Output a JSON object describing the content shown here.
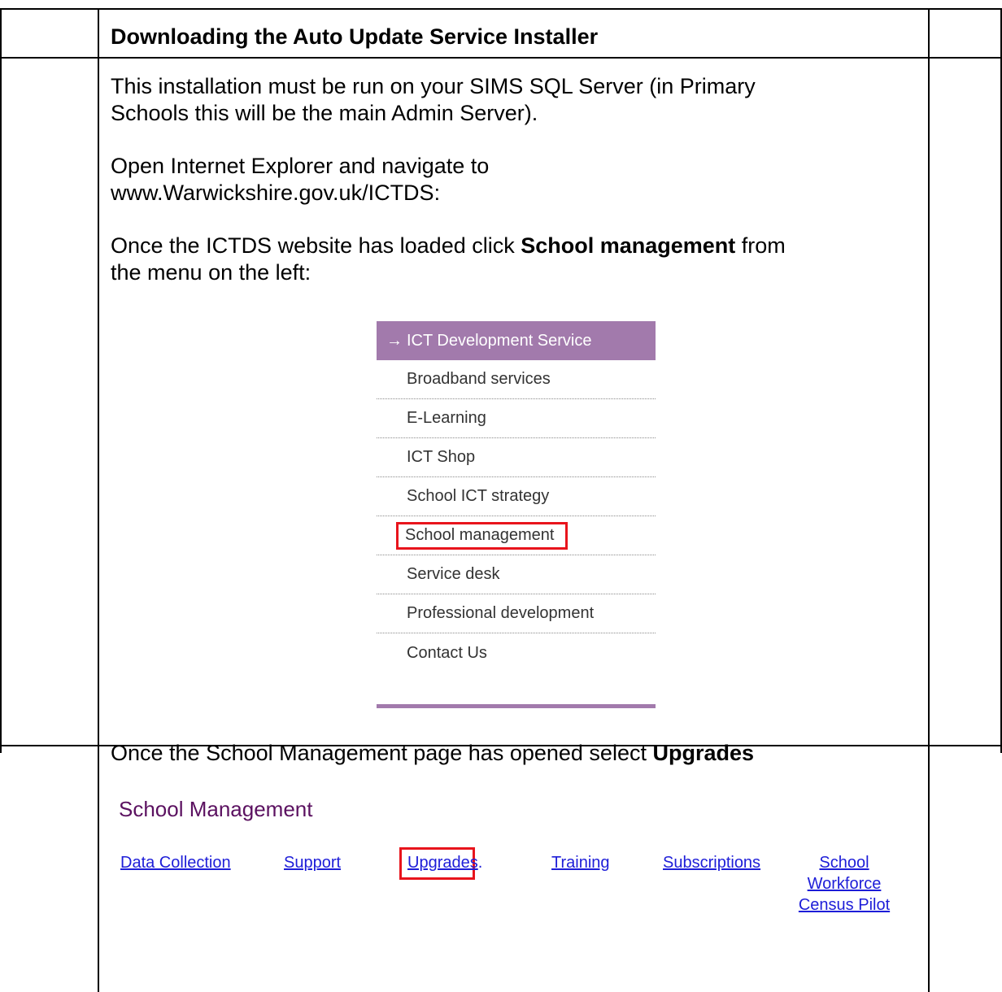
{
  "heading": "Downloading the Auto Update Service Installer",
  "paragraphs": {
    "p1_line1": "This installation must be run on your SIMS SQL Server (in Primary",
    "p1_line2": "Schools this will be the main Admin Server).",
    "p2_line1": "Open Internet Explorer and navigate to",
    "p2_line2": "www.Warwickshire.gov.uk/ICTDS:",
    "p3_pre": "Once the ICTDS website has loaded click ",
    "p3_bold": "School management",
    "p3_post": " from",
    "p3_line2": "the menu on the left:",
    "p4_pre": "Once the School Management page has opened select ",
    "p4_bold": "Upgrades"
  },
  "menu": {
    "header": "ICT Development Service",
    "header_icon": "arrow-right-icon",
    "items": [
      "Broadband services",
      "E-Learning",
      "ICT Shop",
      "School ICT strategy",
      "School management",
      "Service desk",
      "Professional development",
      "Contact Us"
    ],
    "highlighted_item": "School management",
    "accent_color": "#a27aac",
    "highlight_color": "#e8141c"
  },
  "school_management": {
    "title": "School Management",
    "links": {
      "data_collection": "Data Collection",
      "support": "Support",
      "upgrades": "Upgrades",
      "upgrades_suffix": ".",
      "training": "Training",
      "subscriptions": "Subscriptions",
      "school_workforce_1": "School",
      "school_workforce_2": "Workforce",
      "school_workforce_3": "Census Pilot"
    },
    "highlighted_link": "Upgrades",
    "title_color": "#5b1160",
    "link_color": "#1d1dd8"
  }
}
